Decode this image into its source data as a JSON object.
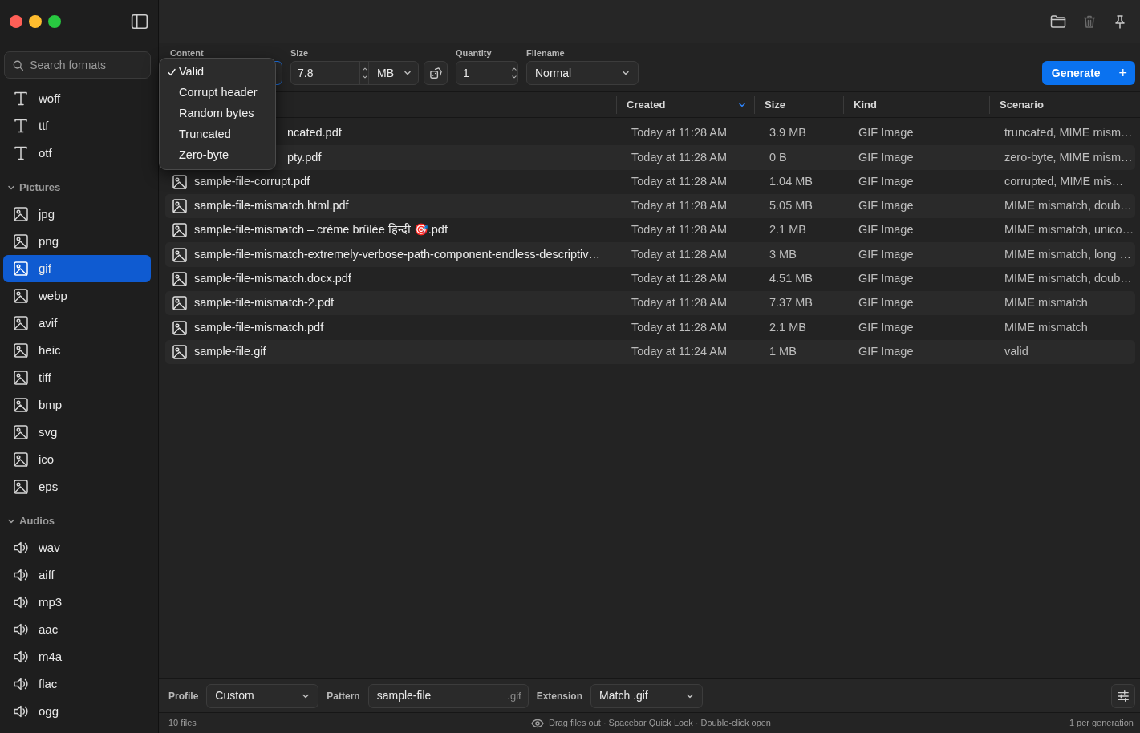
{
  "sidebar": {
    "search": {
      "placeholder": "Search formats"
    },
    "groups": [
      {
        "items": [
          {
            "label": "woff",
            "kind": "font",
            "selected": false
          },
          {
            "label": "ttf",
            "kind": "font",
            "selected": false
          },
          {
            "label": "otf",
            "kind": "font",
            "selected": false
          }
        ]
      },
      {
        "title": "Pictures",
        "expanded": true,
        "items": [
          {
            "label": "jpg",
            "kind": "image",
            "selected": false
          },
          {
            "label": "png",
            "kind": "image",
            "selected": false
          },
          {
            "label": "gif",
            "kind": "image",
            "selected": true
          },
          {
            "label": "webp",
            "kind": "image",
            "selected": false
          },
          {
            "label": "avif",
            "kind": "image",
            "selected": false
          },
          {
            "label": "heic",
            "kind": "image",
            "selected": false
          },
          {
            "label": "tiff",
            "kind": "image",
            "selected": false
          },
          {
            "label": "bmp",
            "kind": "image",
            "selected": false
          },
          {
            "label": "svg",
            "kind": "image",
            "selected": false
          },
          {
            "label": "ico",
            "kind": "image",
            "selected": false
          },
          {
            "label": "eps",
            "kind": "image",
            "selected": false
          }
        ]
      },
      {
        "title": "Audios",
        "expanded": true,
        "items": [
          {
            "label": "wav",
            "kind": "audio",
            "selected": false
          },
          {
            "label": "aiff",
            "kind": "audio",
            "selected": false
          },
          {
            "label": "mp3",
            "kind": "audio",
            "selected": false
          },
          {
            "label": "aac",
            "kind": "audio",
            "selected": false
          },
          {
            "label": "m4a",
            "kind": "audio",
            "selected": false
          },
          {
            "label": "flac",
            "kind": "audio",
            "selected": false
          },
          {
            "label": "ogg",
            "kind": "audio",
            "selected": false
          }
        ]
      }
    ]
  },
  "toolbar": {
    "content": {
      "label": "Content"
    },
    "size": {
      "label": "Size",
      "value": "7.8",
      "unit": "MB"
    },
    "quantity": {
      "label": "Quantity",
      "value": "1"
    },
    "filename": {
      "label": "Filename",
      "value": "Normal"
    },
    "generate": "Generate",
    "add": "+"
  },
  "content_menu": {
    "options": [
      {
        "label": "Valid",
        "selected": true
      },
      {
        "label": "Corrupt header",
        "selected": false
      },
      {
        "label": "Random bytes",
        "selected": false
      },
      {
        "label": "Truncated",
        "selected": false
      },
      {
        "label": "Zero-byte",
        "selected": false
      }
    ]
  },
  "table": {
    "columns": [
      {
        "label": "Created",
        "sorted": true
      },
      {
        "label": "Size",
        "sorted": false
      },
      {
        "label": "Kind",
        "sorted": false
      },
      {
        "label": "Scenario",
        "sorted": false
      }
    ],
    "rows": [
      {
        "name": "ncated.pdf",
        "covered": true,
        "created": "Today at 11:28 AM",
        "size": "3.9 MB",
        "kind": "GIF Image",
        "scenario": "truncated, MIME mism…"
      },
      {
        "name": "pty.pdf",
        "covered": true,
        "created": "Today at 11:28 AM",
        "size": "0 B",
        "kind": "GIF Image",
        "scenario": "zero-byte, MIME mism…"
      },
      {
        "name": "sample-file-corrupt.pdf",
        "covered": false,
        "created": "Today at 11:28 AM",
        "size": "1.04 MB",
        "kind": "GIF Image",
        "scenario": "corrupted, MIME mis…"
      },
      {
        "name": "sample-file-mismatch.html.pdf",
        "covered": false,
        "created": "Today at 11:28 AM",
        "size": "5.05 MB",
        "kind": "GIF Image",
        "scenario": "MIME mismatch, doub…"
      },
      {
        "name": "sample-file-mismatch – crème brûlée हिन्दी 🎯.pdf",
        "covered": false,
        "created": "Today at 11:28 AM",
        "size": "2.1 MB",
        "kind": "GIF Image",
        "scenario": "MIME mismatch, unico…"
      },
      {
        "name": "sample-file-mismatch-extremely-verbose-path-component-endless-descriptiv…",
        "covered": false,
        "created": "Today at 11:28 AM",
        "size": "3 MB",
        "kind": "GIF Image",
        "scenario": "MIME mismatch, long …"
      },
      {
        "name": "sample-file-mismatch.docx.pdf",
        "covered": false,
        "created": "Today at 11:28 AM",
        "size": "4.51 MB",
        "kind": "GIF Image",
        "scenario": "MIME mismatch, doub…"
      },
      {
        "name": "sample-file-mismatch-2.pdf",
        "covered": false,
        "created": "Today at 11:28 AM",
        "size": "7.37 MB",
        "kind": "GIF Image",
        "scenario": "MIME mismatch"
      },
      {
        "name": "sample-file-mismatch.pdf",
        "covered": false,
        "created": "Today at 11:28 AM",
        "size": "2.1 MB",
        "kind": "GIF Image",
        "scenario": "MIME mismatch"
      },
      {
        "name": "sample-file.gif",
        "covered": false,
        "created": "Today at 11:24 AM",
        "size": "1 MB",
        "kind": "GIF Image",
        "scenario": "valid"
      }
    ]
  },
  "footer": {
    "profile": {
      "label": "Profile",
      "value": "Custom"
    },
    "pattern": {
      "label": "Pattern",
      "value": "sample-file",
      "suffix": ".gif"
    },
    "extension": {
      "label": "Extension",
      "value": "Match .gif"
    }
  },
  "status_bar": {
    "count": "10 files",
    "hint": "Drag files out · Spacebar Quick Look · Double-click open",
    "per": "1 per generation"
  }
}
